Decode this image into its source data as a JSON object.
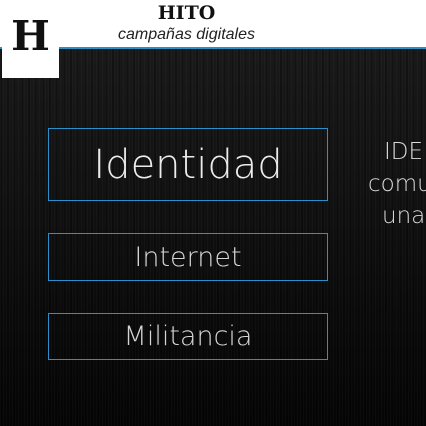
{
  "header": {
    "logo_letter": "H",
    "title": "HITO",
    "subtitle": "campañas digitales"
  },
  "nav": {
    "items": [
      {
        "label": "Identidad"
      },
      {
        "label": "Internet"
      },
      {
        "label": "Militancia"
      }
    ]
  },
  "side_text": {
    "lines": [
      "IDE",
      "comu",
      "una"
    ]
  },
  "colors": {
    "accent": "#2a8fcb",
    "header_bg": "#ffffff",
    "page_bg": "#0d0d0d",
    "button_text": "#d6d6d6"
  }
}
